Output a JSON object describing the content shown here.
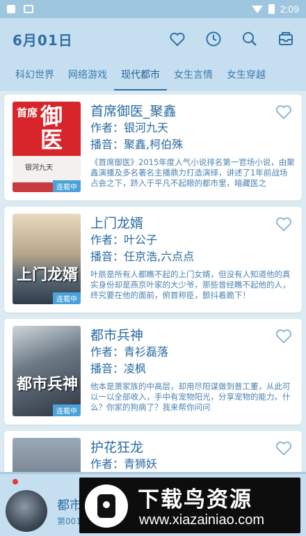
{
  "status_bar": {
    "time": "2:09"
  },
  "header": {
    "date_title": "6月01日",
    "icons": [
      "heart-icon",
      "clock-icon",
      "search-icon",
      "inbox-icon"
    ]
  },
  "tabs": [
    {
      "label": "科幻世界",
      "active": false
    },
    {
      "label": "网络游戏",
      "active": false
    },
    {
      "label": "现代都市",
      "active": true
    },
    {
      "label": "女生言情",
      "active": false
    },
    {
      "label": "女生穿越",
      "active": false
    }
  ],
  "books": [
    {
      "title": "首席御医_聚鑫",
      "author_label": "作者：",
      "author": "银河九天",
      "narrator_label": "播音：",
      "narrator": "聚鑫,柯伯殊",
      "description": "《首席御医》2015年度人气小说排名第一官场小说，由聚鑫演播及多名著名主播鼎力打造演绎，讲述了1年前战场占会之下，跻入于平凡不起眼的都市里，暗藏医之",
      "cover_text_a": "首席",
      "cover_text_b": "御医",
      "cover_author": "银河九天",
      "cover_tag": "连载中"
    },
    {
      "title": "上门龙婿",
      "author_label": "作者：",
      "author": "叶公子",
      "narrator_label": "播音：",
      "narrator": "任京浩,六点点",
      "description": "叶辰是所有人都瞧不起的上门女婿，但没有人知道他的真实身份却是燕京叶家的大少爷，那些曾经瞧不起他的人，终究要在他的面前，俯首称臣，颤抖着跪下！",
      "cover_title": "上门龙婿",
      "cover_tag": "连载中"
    },
    {
      "title": "都市兵神",
      "author_label": "作者：",
      "author": "青衫磊落",
      "narrator_label": "播音：",
      "narrator": "凌枫",
      "description": "他本是萧家族的中高层，却用尽阳谋做到普工董，从此可以一以全部收入，手中有宠物阳光，分享宠物的能力。什么？你家的狗病了？我来帮你问问",
      "cover_title": "都市兵神",
      "cover_tag": "连载中"
    },
    {
      "title": "护花狂龙",
      "author_label": "作者：",
      "author": "青狮妖"
    }
  ],
  "player": {
    "title": "都市",
    "subtitle": "第001"
  },
  "watermark": {
    "title": "下载鸟资源",
    "url": "www.xiazainiao.com"
  }
}
